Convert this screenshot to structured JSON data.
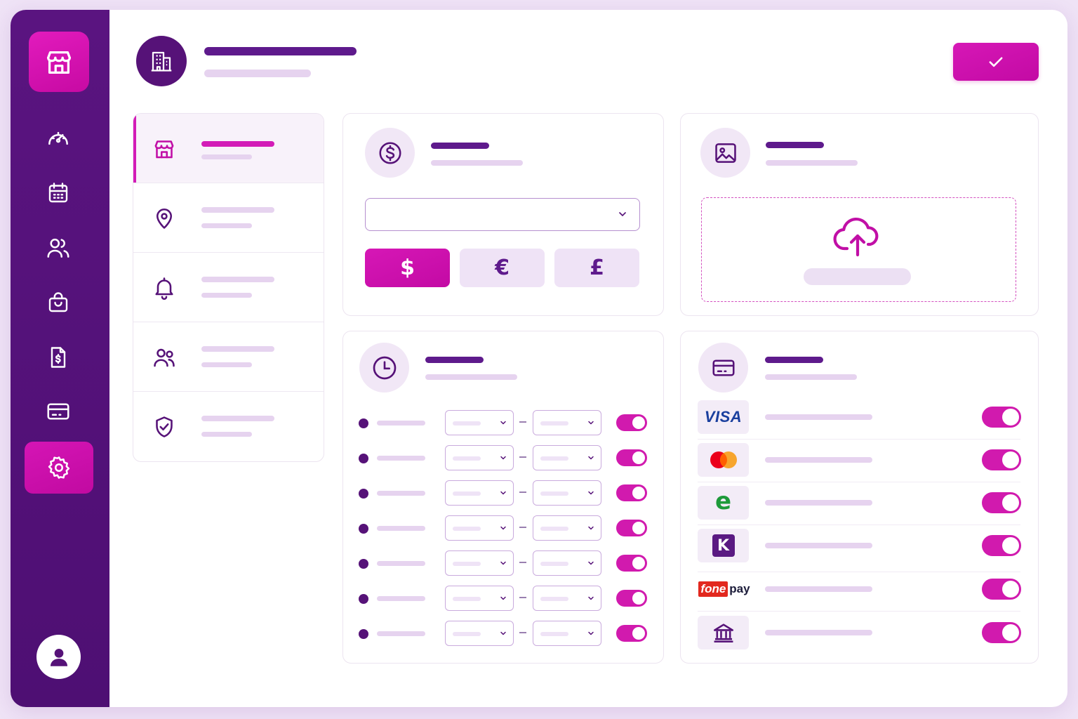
{
  "colors": {
    "primary_dark": "#561278",
    "accent_pink": "#d31cb7",
    "light_lavender": "#efe3f6",
    "visa_blue": "#1a3f9e",
    "mastercard_red": "#eb001b",
    "mastercard_orange": "#f79e1b",
    "esewa_green": "#1e9a3a",
    "khalti_purple": "#5a1a82",
    "fonepay_red": "#e2281e"
  },
  "sidebar": {
    "items": [
      {
        "icon": "store-icon",
        "active": false
      },
      {
        "icon": "dashboard-gauge-icon",
        "active": false
      },
      {
        "icon": "calendar-icon",
        "active": false
      },
      {
        "icon": "users-icon",
        "active": false
      },
      {
        "icon": "shopping-bag-icon",
        "active": false
      },
      {
        "icon": "invoice-icon",
        "active": false
      },
      {
        "icon": "credit-card-icon",
        "active": false
      },
      {
        "icon": "gear-icon",
        "active": true
      }
    ],
    "avatar_icon": "user-avatar-icon"
  },
  "header": {
    "icon": "building-icon",
    "save_icon": "check-icon"
  },
  "settings_nav": {
    "items": [
      {
        "icon": "store-icon",
        "active": true
      },
      {
        "icon": "location-pin-icon",
        "active": false
      },
      {
        "icon": "bell-icon",
        "active": false
      },
      {
        "icon": "users-icon",
        "active": false
      },
      {
        "icon": "shield-check-icon",
        "active": false
      }
    ]
  },
  "currency_card": {
    "icon": "dollar-circle-icon",
    "options": [
      "$",
      "€",
      "£"
    ],
    "selected": "$"
  },
  "logo_card": {
    "icon": "image-icon",
    "upload_icon": "cloud-upload-icon"
  },
  "hours_card": {
    "icon": "clock-icon",
    "rows": [
      {
        "enabled": true
      },
      {
        "enabled": true
      },
      {
        "enabled": true
      },
      {
        "enabled": true
      },
      {
        "enabled": true
      },
      {
        "enabled": true
      },
      {
        "enabled": true
      }
    ]
  },
  "payments_card": {
    "icon": "credit-card-icon",
    "methods": [
      {
        "logo": "visa-logo",
        "label": "VISA",
        "enabled": true
      },
      {
        "logo": "mastercard-logo",
        "label": "",
        "enabled": true
      },
      {
        "logo": "esewa-logo",
        "label": "e",
        "enabled": true
      },
      {
        "logo": "khalti-logo",
        "label": "K",
        "enabled": true
      },
      {
        "logo": "fonepay-logo",
        "label_fone": "fone",
        "label_pay": "pay",
        "enabled": true
      },
      {
        "logo": "bank-icon",
        "label": "",
        "enabled": true
      }
    ]
  }
}
